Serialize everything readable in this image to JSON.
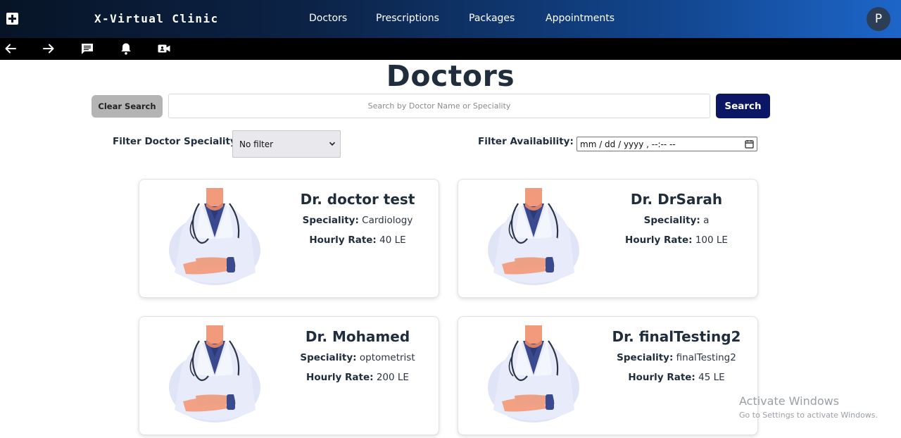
{
  "app": {
    "brand": "X-Virtual Clinic",
    "avatar_initial": "P"
  },
  "nav": {
    "links": [
      "Doctors",
      "Prescriptions",
      "Packages",
      "Appointments"
    ]
  },
  "toolbar": {
    "icons": [
      "back-arrow-icon",
      "forward-arrow-icon",
      "chat-icon",
      "bell-icon",
      "video-call-icon"
    ]
  },
  "page": {
    "title": "Doctors"
  },
  "search": {
    "clear_label": "Clear Search",
    "placeholder": "Search by Doctor Name or Speciality",
    "value": "",
    "button_label": "Search"
  },
  "filters": {
    "speciality_label": "Filter Doctor Speciality:",
    "speciality_value": "No filter",
    "availability_label": "Filter Availability:",
    "availability_value": "mm / dd / yyyy , --:-- --"
  },
  "doctors": [
    {
      "name": "Dr. doctor test",
      "speciality_label": "Speciality:",
      "speciality": "Cardiology",
      "rate_label": "Hourly Rate:",
      "rate": "40 LE"
    },
    {
      "name": "Dr. DrSarah",
      "speciality_label": "Speciality:",
      "speciality": "a",
      "rate_label": "Hourly Rate:",
      "rate": "100 LE"
    },
    {
      "name": "Dr. Mohamed",
      "speciality_label": "Speciality:",
      "speciality": "optometrist",
      "rate_label": "Hourly Rate:",
      "rate": "200 LE"
    },
    {
      "name": "Dr. finalTesting2",
      "speciality_label": "Speciality:",
      "speciality": "finalTesting2",
      "rate_label": "Hourly Rate:",
      "rate": "45 LE"
    }
  ],
  "watermark": {
    "title": "Activate Windows",
    "subtitle": "Go to Settings to activate Windows."
  },
  "colors": {
    "navbar_start": "#071426",
    "navbar_end": "#1d66c9",
    "search_button": "#0b1664",
    "clear_button": "#b4b4b4",
    "heading": "#1f2d3d"
  }
}
